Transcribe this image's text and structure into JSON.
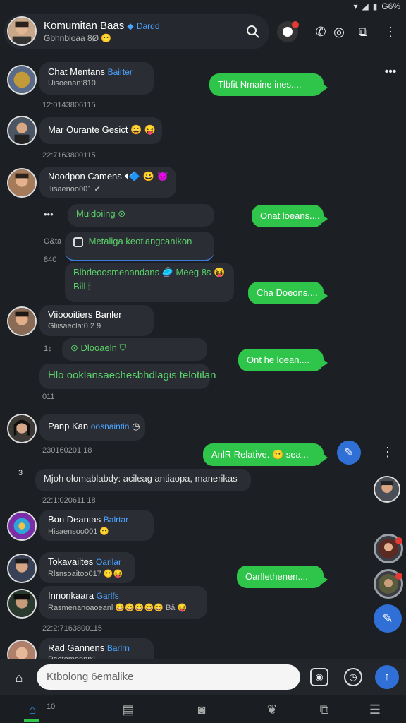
{
  "status": {
    "battery": "G6%"
  },
  "header": {
    "title": "Komumitan Baas",
    "badge": "Dardd",
    "subtitle": "Gbhnbloaa 8Ø 😶"
  },
  "messages": [
    {
      "name": "Chat Mentans",
      "badge": "Bairter",
      "sub": "Uisoenan:810",
      "ts": "12:0143806115"
    },
    {
      "name": "Mar Ourante Gesict 😄 😝",
      "ts": "22:7163800115"
    },
    {
      "name": "Noodpon Camens ⏴🔷 😀 😈",
      "sub": "Ilisaenoo001 ✔"
    },
    {
      "name": "Viioooitiers Banler",
      "sub": "Gliisaecla:0 2 9"
    },
    {
      "name": "Panp Kan",
      "badge": "oosnaintin"
    },
    {
      "name": "Bon Deantas",
      "badge": "Balrtar",
      "sub": "Hisaensoo001 😶"
    },
    {
      "name": "Tokavailtes",
      "badge": "Oarllar",
      "sub": "Rlsnsoaitoo017 😶😝"
    },
    {
      "name": "Innonkaara",
      "badge": "Garlfs",
      "sub": "Rasmenanoaoeanl 😄😄😄😄😄 Bå 😝"
    },
    {
      "name": "Rad Gannens",
      "badge": "Barlrn",
      "sub": "Rsotomonnn1"
    }
  ],
  "inline": {
    "dots1": "•••",
    "mulding": "Muldoiing",
    "link": "Metaliga keotlangcanikon",
    "ts_side1": "O&ta",
    "ts_side2": "840",
    "long1": "Blbdeoosmenandans 🥏 Meeg 8s 😝",
    "long1b": "Bill 🕯",
    "ts_small1": "1↕",
    "pill2": "Dlooaeln",
    "long2": "Hlo ooklansaechesbhdlagis telotilan",
    "ts_small2": "011",
    "long3": "Mjoh olomablabdy: acileag antiaopa, manerikas",
    "ts_panp": "230160201 18",
    "ts_mjoh": "22:1:020611 18",
    "ts_inn": "22:2:7163800115",
    "num3": "3"
  },
  "green": [
    "Tlbfit Nmaine ines....",
    "Onat loeans....",
    "Cha Doeons....",
    "Ont he loean....",
    "AnlR Relative. 😶 sea...",
    "Oarllethenen...."
  ],
  "composer": {
    "placeholder": "Ktbolong 6emalike"
  },
  "nav": {
    "badge": "10"
  }
}
